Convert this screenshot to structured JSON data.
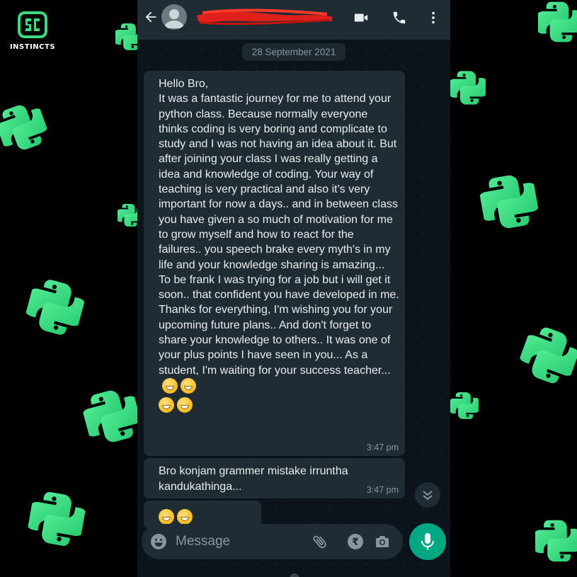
{
  "brand": {
    "text": "INSTINCTS"
  },
  "chat": {
    "date_label": "28 September 2021",
    "messages": [
      {
        "text": "Hello Bro,\nIt was a fantastic journey for me to attend your python class. Because normally everyone thinks coding is very boring and complicate to study and I was not having an idea about it. But after joining your class I was really getting a idea and knowledge of coding. Your way of teaching is very practical and also it's very important for now a days.. and in between class you have given a so much of motivation for me to grow myself and how to react for the failures.. you speech brake every myth's in my life and your knowledge sharing is amazing... To be frank I was trying for a job but i will get it soon.. that confident you have developed in me. Thanks for everything, I'm wishing you for your upcoming future plans.. And don't forget to share your knowledge to others.. It was one of your plus points I have seen in you... As a student, I'm waiting for your success teacher...",
        "emoji": "grinning-face-emoji",
        "time": "3:47 pm"
      },
      {
        "text": "Bro konjam grammer mistake irruntha\nkandukathinga...",
        "time": "3:47 pm"
      },
      {
        "emoji": "grinning-face-emoji"
      }
    ]
  },
  "composer": {
    "placeholder": "Message",
    "icons": [
      "emoji-icon",
      "attach-icon",
      "rupee-payment-icon",
      "camera-icon",
      "mic-icon"
    ]
  },
  "header": {
    "contact_name_redacted": true,
    "icons": [
      "back-arrow-icon",
      "video-call-icon",
      "voice-call-icon",
      "more-options-icon"
    ]
  },
  "colors": {
    "header_bg": "#1f2c34",
    "chat_bg": "#0b141a",
    "bubble_bg": "#202c33",
    "accent_green": "#00a884",
    "python_logo_green": "#3ddc84",
    "redaction_red": "#e0201b"
  }
}
